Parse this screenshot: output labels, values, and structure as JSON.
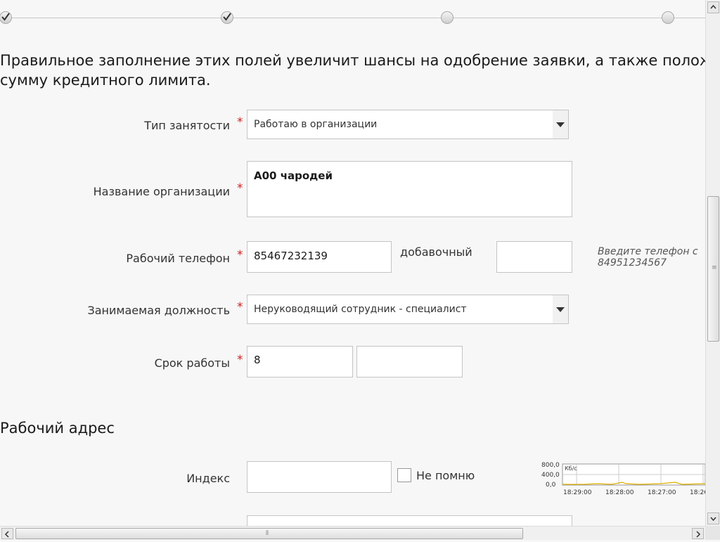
{
  "progress": {
    "steps": [
      {
        "state": "done",
        "icon": "check-icon"
      },
      {
        "state": "done",
        "icon": "check-icon"
      },
      {
        "state": "pending"
      },
      {
        "state": "pending"
      }
    ]
  },
  "intro": {
    "line1": "Правильное заполнение этих полей увеличит шансы на одобрение заявки, а также полож",
    "line2": "сумму кредитного лимита."
  },
  "form": {
    "employment_type": {
      "label": "Тип занятости",
      "required": "*",
      "value": "Работаю в организации"
    },
    "organization": {
      "label": "Название организации",
      "required": "*",
      "value": "А00 чародей"
    },
    "work_phone": {
      "label": "Рабочий телефон",
      "required": "*",
      "value": "85467232139",
      "ext_label": "добавочный",
      "ext_value": "",
      "hint_line1": "Введите телефон с",
      "hint_line2": "84951234567"
    },
    "position": {
      "label": "Занимаемая должность",
      "required": "*",
      "value": "Неруководящий сотрудник - специалист"
    },
    "tenure": {
      "label": "Срок работы",
      "required": "*",
      "value1": "8",
      "value2": ""
    }
  },
  "work_address": {
    "title": "Рабочий адрес",
    "index_label": "Индекс",
    "index_value": "",
    "dont_remember_label": "Не помню",
    "dont_remember_checked": false
  },
  "net_widget": {
    "y_ticks": [
      "800,0",
      "400,0",
      "0,0"
    ],
    "unit": "Кб/с",
    "x_ticks": [
      "18:29:00",
      "18:28:00",
      "18:27:00",
      "18:26:00"
    ]
  },
  "colors": {
    "required": "#d21f1f",
    "chart_line": "#e0b000"
  }
}
